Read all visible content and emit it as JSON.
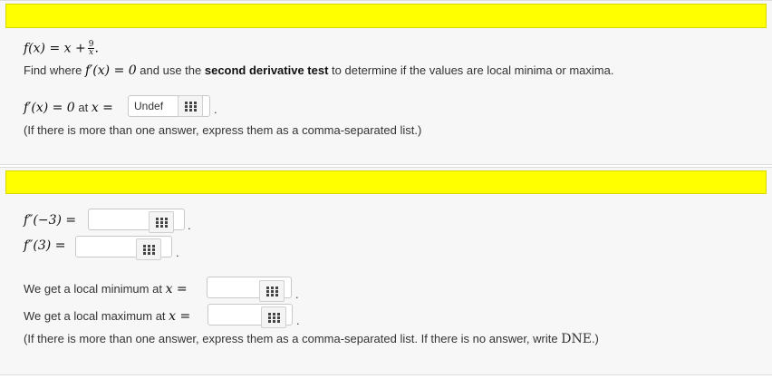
{
  "part1": {
    "function_lhs": "f(x) = x +",
    "frac_num": "9",
    "frac_den": "x",
    "frac_tail": ".",
    "instr_pre": "Find where",
    "instr_fprime": "f′(x) = 0",
    "instr_mid": "and use the",
    "instr_bold": "second derivative test",
    "instr_post": "to determine if the values are local minima or maxima.",
    "q_label": "f′(x) = 0",
    "q_at": "at",
    "q_x": "x =",
    "q_value": "Undef",
    "q_tail": ".",
    "hint": "(If there is more than one answer, express them as a comma-separated list.)"
  },
  "part2": {
    "fpp_neg3_label": "f″(−3) =",
    "fpp_neg3_value": "",
    "fpp_3_label": "f″(3) =",
    "fpp_3_value": "",
    "tail": ".",
    "min_pre": "We get a local minimum at",
    "min_x": "x =",
    "min_value": "",
    "max_pre": "We get a local maximum at",
    "max_x": "x =",
    "max_value": "",
    "hint_pre": "(If there is more than one answer, express them as a comma-separated list. If there is no answer, write",
    "hint_dne": "DNE",
    "hint_post": ".)"
  },
  "icons": {
    "keypad": "keypad-grid-icon"
  },
  "colors": {
    "banner": "#ffff00",
    "panel": "#f7f7f7"
  }
}
